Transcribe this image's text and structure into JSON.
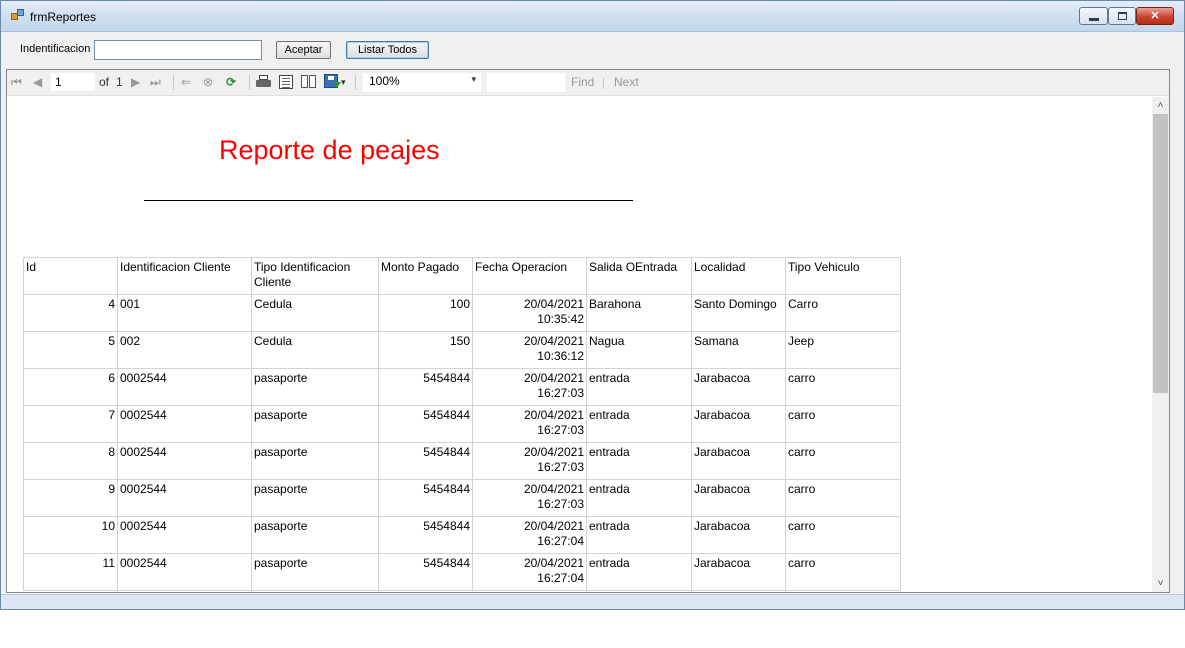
{
  "window": {
    "title": "frmReportes",
    "min_glyph": "",
    "max_glyph": "",
    "close_glyph": "✕"
  },
  "form": {
    "ident_label": "Indentificacion",
    "ident_value": "",
    "aceptar_label": "Aceptar",
    "listar_label": "Listar Todos"
  },
  "toolbar": {
    "page_value": "1",
    "of_label": "of",
    "total_pages": "1",
    "first_glyph": "⏮",
    "prev_glyph": "◀",
    "next_glyph": "▶",
    "last_glyph": "⏭",
    "back_glyph": "⇐",
    "stop_glyph": "⊗",
    "refresh_glyph": "⟳",
    "export_dropdown_glyph": "▾",
    "zoom_value": "100%",
    "zoom_dropdown_glyph": "▾",
    "find_label": "Find",
    "find_separator": "|",
    "next_label": "Next",
    "icons": [
      "first-page-icon",
      "previous-page-icon",
      "next-page-icon",
      "last-page-icon",
      "back-icon",
      "stop-icon",
      "refresh-icon",
      "print-icon",
      "print-layout-icon",
      "page-setup-icon",
      "export-icon"
    ]
  },
  "report": {
    "title": "Reporte de peajes",
    "title_color": "#ff0000",
    "columns": [
      "Id",
      "Identificacion Cliente",
      "Tipo Identificacion Cliente",
      "Monto Pagado",
      "Fecha Operacion",
      "Salida OEntrada",
      "Localidad",
      "Tipo Vehiculo"
    ],
    "rows": [
      {
        "id": "4",
        "ident": "001",
        "tipo": "Cedula",
        "monto": "100",
        "fecha": "20/04/2021 10:35:42",
        "salida": "Barahona",
        "localidad": "Santo Domingo",
        "vehiculo": "Carro"
      },
      {
        "id": "5",
        "ident": "002",
        "tipo": "Cedula",
        "monto": "150",
        "fecha": "20/04/2021 10:36:12",
        "salida": "Nagua",
        "localidad": "Samana",
        "vehiculo": "Jeep"
      },
      {
        "id": "6",
        "ident": "0002544",
        "tipo": "pasaporte",
        "monto": "5454844",
        "fecha": "20/04/2021 16:27:03",
        "salida": "entrada",
        "localidad": "Jarabacoa",
        "vehiculo": "carro"
      },
      {
        "id": "7",
        "ident": "0002544",
        "tipo": "pasaporte",
        "monto": "5454844",
        "fecha": "20/04/2021 16:27:03",
        "salida": "entrada",
        "localidad": "Jarabacoa",
        "vehiculo": "carro"
      },
      {
        "id": "8",
        "ident": "0002544",
        "tipo": "pasaporte",
        "monto": "5454844",
        "fecha": "20/04/2021 16:27:03",
        "salida": "entrada",
        "localidad": "Jarabacoa",
        "vehiculo": "carro"
      },
      {
        "id": "9",
        "ident": "0002544",
        "tipo": "pasaporte",
        "monto": "5454844",
        "fecha": "20/04/2021 16:27:03",
        "salida": "entrada",
        "localidad": "Jarabacoa",
        "vehiculo": "carro"
      },
      {
        "id": "10",
        "ident": "0002544",
        "tipo": "pasaporte",
        "monto": "5454844",
        "fecha": "20/04/2021 16:27:04",
        "salida": "entrada",
        "localidad": "Jarabacoa",
        "vehiculo": "carro"
      },
      {
        "id": "11",
        "ident": "0002544",
        "tipo": "pasaporte",
        "monto": "5454844",
        "fecha": "20/04/2021 16:27:04",
        "salida": "entrada",
        "localidad": "Jarabacoa",
        "vehiculo": "carro"
      }
    ]
  },
  "scrollbar": {
    "up_glyph": "˄",
    "down_glyph": "˅"
  }
}
